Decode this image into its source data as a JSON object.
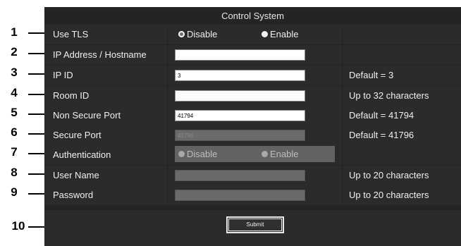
{
  "panel_title": "Control System",
  "callouts": [
    "1",
    "2",
    "3",
    "4",
    "5",
    "6",
    "7",
    "8",
    "9",
    "10"
  ],
  "rows": [
    {
      "label": "Use TLS",
      "note": ""
    },
    {
      "label": "IP Address / Hostname",
      "note": "",
      "value": ""
    },
    {
      "label": "IP ID",
      "note": "Default = 3",
      "value": "3"
    },
    {
      "label": "Room ID",
      "note": "Up to 32 characters",
      "value": ""
    },
    {
      "label": "Non Secure Port",
      "note": "Default = 41794",
      "value": "41794"
    },
    {
      "label": "Secure Port",
      "note": "Default = 41796",
      "value": "41796"
    },
    {
      "label": "Authentication",
      "note": ""
    },
    {
      "label": "User Name",
      "note": "Up to 20 characters",
      "value": ""
    },
    {
      "label": "Password",
      "note": "Up to 20 characters",
      "value": ""
    }
  ],
  "tls": {
    "disable": "Disable",
    "enable": "Enable",
    "selected": "Disable"
  },
  "auth": {
    "disable": "Disable",
    "enable": "Enable"
  },
  "submit_label": "Submit",
  "colors": {
    "panel": "#242424",
    "cell": "#2b2b2b",
    "text": "#efefef"
  }
}
